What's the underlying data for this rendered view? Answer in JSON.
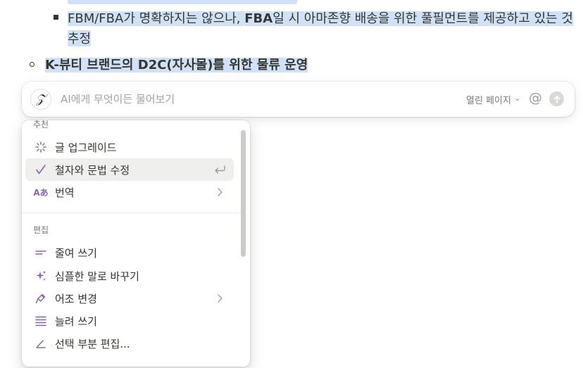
{
  "document": {
    "sub_bullet_text_part1": "FBM/FBA가 명확하지는 않으나, ",
    "sub_bullet_text_bold": "FBA",
    "sub_bullet_text_part2": "일 시 아마존향 배송을 위한 풀필먼트를 제공하고 있는 것으로",
    "sub_bullet_text_line2": "추정",
    "bullet_text": "K-뷰티 브랜드의 D2C(자사몰)를 위한 물류 운영"
  },
  "ai_bar": {
    "avatar_glyph": "𝒵",
    "placeholder": "AI에게 무엇이든 물어보기",
    "scope_label": "열린 페이지",
    "scope_chevron": "⌄",
    "at_glyph": "@"
  },
  "menu": {
    "section_recommend": "추천",
    "section_edit": "편집",
    "items": [
      {
        "label": "글 업그레이드",
        "icon": "sparkle-burst-icon"
      },
      {
        "label": "철자와 문법 수정",
        "icon": "checkmark-icon",
        "tail": "return-icon"
      },
      {
        "label": "번역",
        "icon": "translate-icon",
        "icon_text": "Aあ",
        "tail": "chevron-right-icon"
      },
      {
        "label": "줄여 쓰기",
        "icon": "shorten-lines-icon"
      },
      {
        "label": "심플한 말로 바꾸기",
        "icon": "sparkles-icon"
      },
      {
        "label": "어조 변경",
        "icon": "mic-icon",
        "tail": "chevron-right-icon"
      },
      {
        "label": "늘려 쓰기",
        "icon": "lengthen-lines-icon"
      },
      {
        "label": "선택 부분 편집...",
        "icon": "pencil-edit-icon"
      }
    ]
  },
  "colors": {
    "selection_highlight": "#cfe2f7",
    "ai_accent_purple": "#8a63b8",
    "text_primary": "#37352f",
    "text_secondary": "#787774"
  }
}
